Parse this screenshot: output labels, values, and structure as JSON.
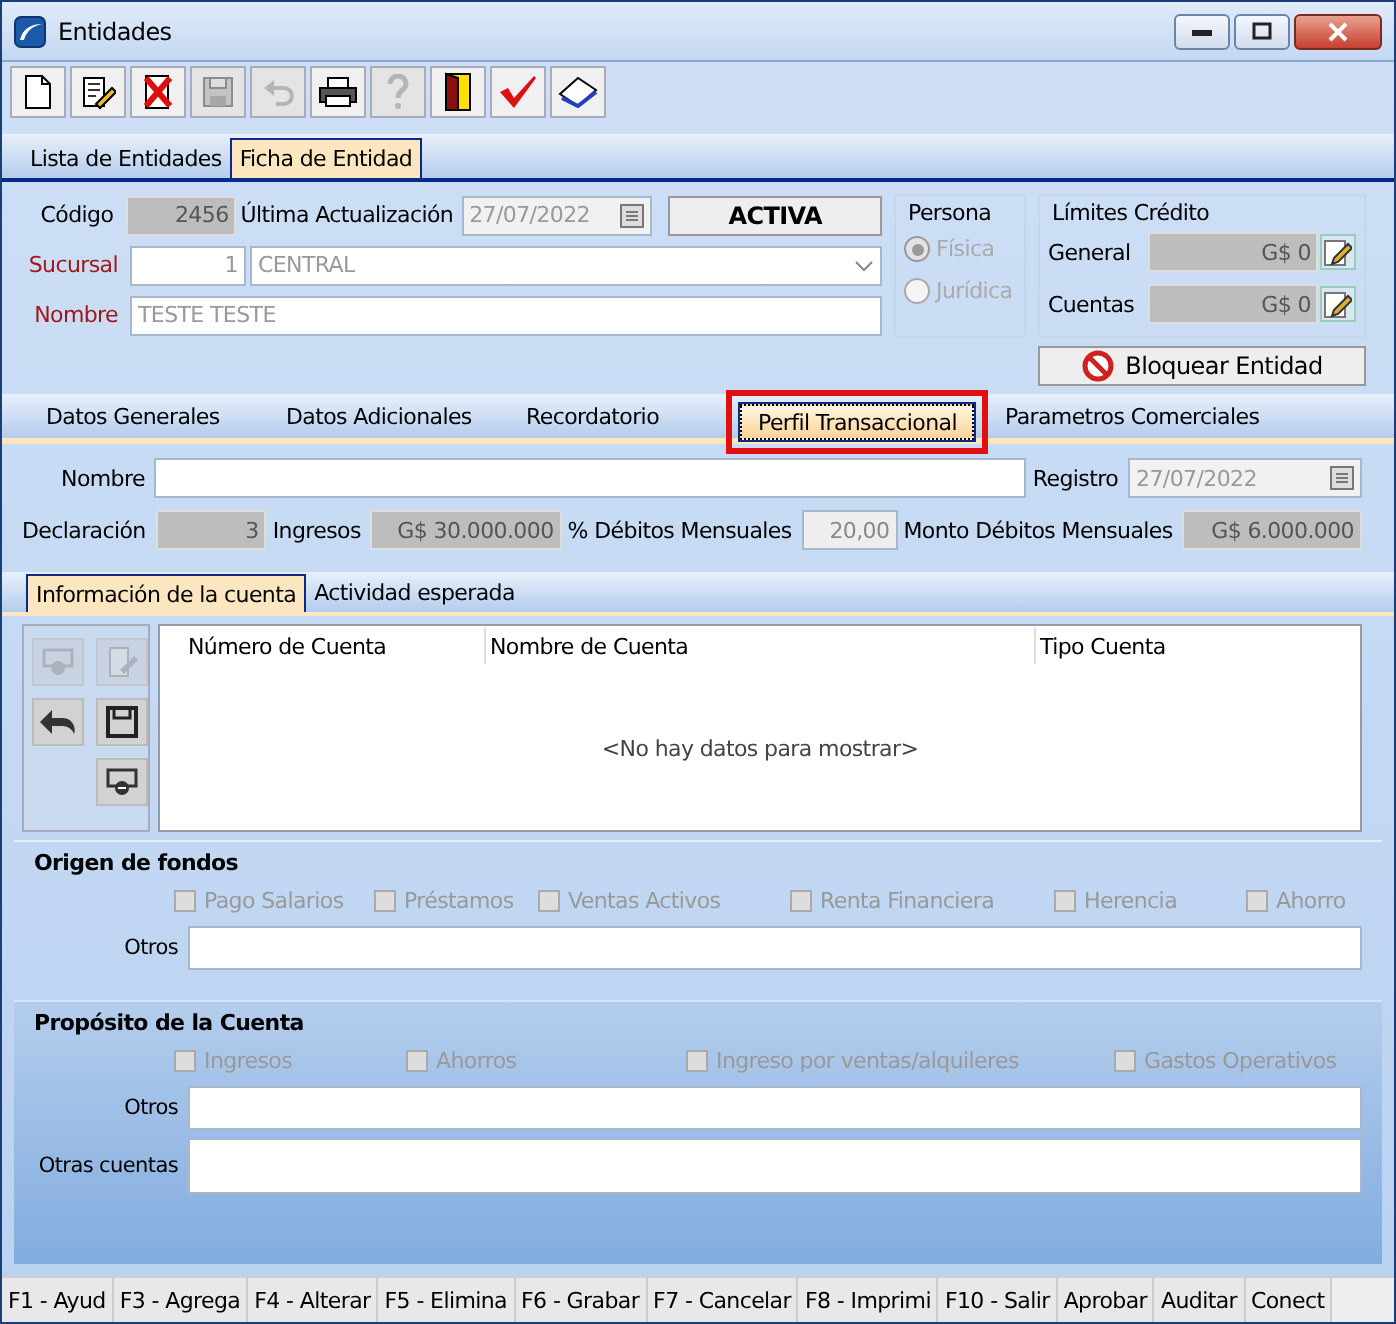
{
  "window": {
    "title": "Entidades"
  },
  "toolbar": [
    {
      "kind": "new",
      "disabled": false
    },
    {
      "kind": "edit",
      "disabled": false
    },
    {
      "kind": "delete",
      "disabled": false
    },
    {
      "kind": "save",
      "disabled": true
    },
    {
      "kind": "undo",
      "disabled": true
    },
    {
      "kind": "print",
      "disabled": false
    },
    {
      "kind": "help",
      "disabled": true
    },
    {
      "kind": "exit",
      "disabled": false
    },
    {
      "kind": "check",
      "disabled": false
    },
    {
      "kind": "book",
      "disabled": false
    }
  ],
  "main_tabs": [
    {
      "label": "Lista de Entidades",
      "selected": false
    },
    {
      "label": "Ficha de Entidad",
      "selected": true
    }
  ],
  "header": {
    "codigo_label": "Código",
    "codigo": "2456",
    "ultima_label": "Última Actualización",
    "ultima": "27/07/2022",
    "status": "ACTIVA",
    "sucursal_label": "Sucursal",
    "sucursal_num": "1",
    "sucursal": "CENTRAL",
    "nombre_label": "Nombre",
    "nombre": "TESTE TESTE"
  },
  "persona": {
    "title": "Persona",
    "options": [
      {
        "label": "Física",
        "selected": true,
        "disabled": true
      },
      {
        "label": "Jurídica",
        "selected": false,
        "disabled": true
      }
    ]
  },
  "limites": {
    "title": "Límites Crédito",
    "rows": [
      {
        "label": "General",
        "value": "G$ 0"
      },
      {
        "label": "Cuentas",
        "value": "G$ 0"
      }
    ]
  },
  "block_button": "Bloquear Entidad",
  "sub_tabs": [
    {
      "label": "Datos Generales",
      "selected": false,
      "highlighted": false
    },
    {
      "label": "Datos Adicionales",
      "selected": false,
      "highlighted": false
    },
    {
      "label": "Recordatorio",
      "selected": false,
      "highlighted": false
    },
    {
      "label": "Perfil Transaccional",
      "selected": true,
      "highlighted": true
    },
    {
      "label": "Parametros Comerciales",
      "selected": false,
      "highlighted": false
    }
  ],
  "perfil": {
    "nombre_label": "Nombre",
    "registro_label": "Registro",
    "registro": "27/07/2022",
    "declaracion_label": "Declaración",
    "declaracion": "3",
    "ingresos_label": "Ingresos",
    "ingresos": "G$ 30.000.000",
    "debitos_label": "% Débitos Mensuales",
    "debitos": "20,00",
    "monto_label": "Monto Débitos Mensuales",
    "monto": "G$ 6.000.000"
  },
  "inner_tabs": [
    {
      "label": "Información de la cuenta",
      "selected": true
    },
    {
      "label": "Actividad esperada",
      "selected": false
    }
  ],
  "grid_tools": [
    {
      "kind": "add",
      "disabled": true
    },
    {
      "kind": "edit",
      "disabled": true
    },
    {
      "kind": "undo",
      "disabled": false
    },
    {
      "kind": "save",
      "disabled": false
    },
    {
      "kind": "remove",
      "disabled": false
    }
  ],
  "table": {
    "columns": [
      "Número de Cuenta",
      "Nombre de Cuenta",
      "Tipo Cuenta"
    ],
    "empty": "<No hay datos para mostrar>"
  },
  "origen": {
    "title": "Origen de fondos",
    "options": [
      {
        "label": "Pago Salarios",
        "checked": false,
        "disabled": true
      },
      {
        "label": "Préstamos",
        "checked": false,
        "disabled": true
      },
      {
        "label": "Ventas Activos",
        "checked": false,
        "disabled": true
      },
      {
        "label": "Renta Financiera",
        "checked": false,
        "disabled": true
      },
      {
        "label": "Herencia",
        "checked": false,
        "disabled": true
      },
      {
        "label": "Ahorro",
        "checked": false,
        "disabled": true
      }
    ],
    "otros_label": "Otros"
  },
  "proposito": {
    "title": "Propósito de la Cuenta",
    "options": [
      {
        "label": "Ingresos",
        "checked": false,
        "disabled": true
      },
      {
        "label": "Ahorros",
        "checked": false,
        "disabled": true
      },
      {
        "label": "Ingreso por ventas/alquileres",
        "checked": false,
        "disabled": true
      },
      {
        "label": "Gastos Operativos",
        "checked": false,
        "disabled": true
      }
    ],
    "otros_label": "Otros",
    "otras_label": "Otras cuentas"
  },
  "status_bar": [
    "F1 - Ayud",
    "F3 - Agrega",
    "F4 - Alterar",
    "F5 - Elimina",
    "F6 - Grabar",
    "F7 - Cancelar",
    "F8 - Imprimi",
    "F10 - Salir",
    "Aprobar",
    "Auditar",
    "Conect"
  ]
}
